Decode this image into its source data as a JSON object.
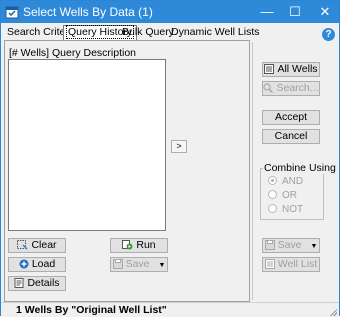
{
  "window": {
    "title": "Select Wells By Data (1)",
    "minimize_glyph": "—",
    "maximize_glyph": "☐",
    "close_glyph": "✕",
    "accent_color": "#2f89d9"
  },
  "tabs": [
    {
      "label": "Search Criteria",
      "selected": false
    },
    {
      "label": "Query History",
      "selected": true
    },
    {
      "label": "Bulk Query",
      "selected": false
    },
    {
      "label": "Dynamic Well Lists",
      "selected": false
    }
  ],
  "help": {
    "glyph": "?"
  },
  "query_list": {
    "header": "[# Wells]  Query Description",
    "items": []
  },
  "transfer_button": {
    "glyph": ">"
  },
  "left_buttons": {
    "clear": "Clear",
    "load": "Load",
    "details": "Details",
    "run": "Run",
    "save": "Save"
  },
  "right_buttons": {
    "all_wells": "All Wells",
    "search": "Search...",
    "accept": "Accept",
    "cancel": "Cancel",
    "save": "Save",
    "well_list": "Well List"
  },
  "combine_using": {
    "label": "Combine Using",
    "options": [
      {
        "label": "AND",
        "selected": true
      },
      {
        "label": "OR",
        "selected": false
      },
      {
        "label": "NOT",
        "selected": false
      }
    ]
  },
  "status": {
    "text": "1 Wells By \"Original Well List\""
  }
}
